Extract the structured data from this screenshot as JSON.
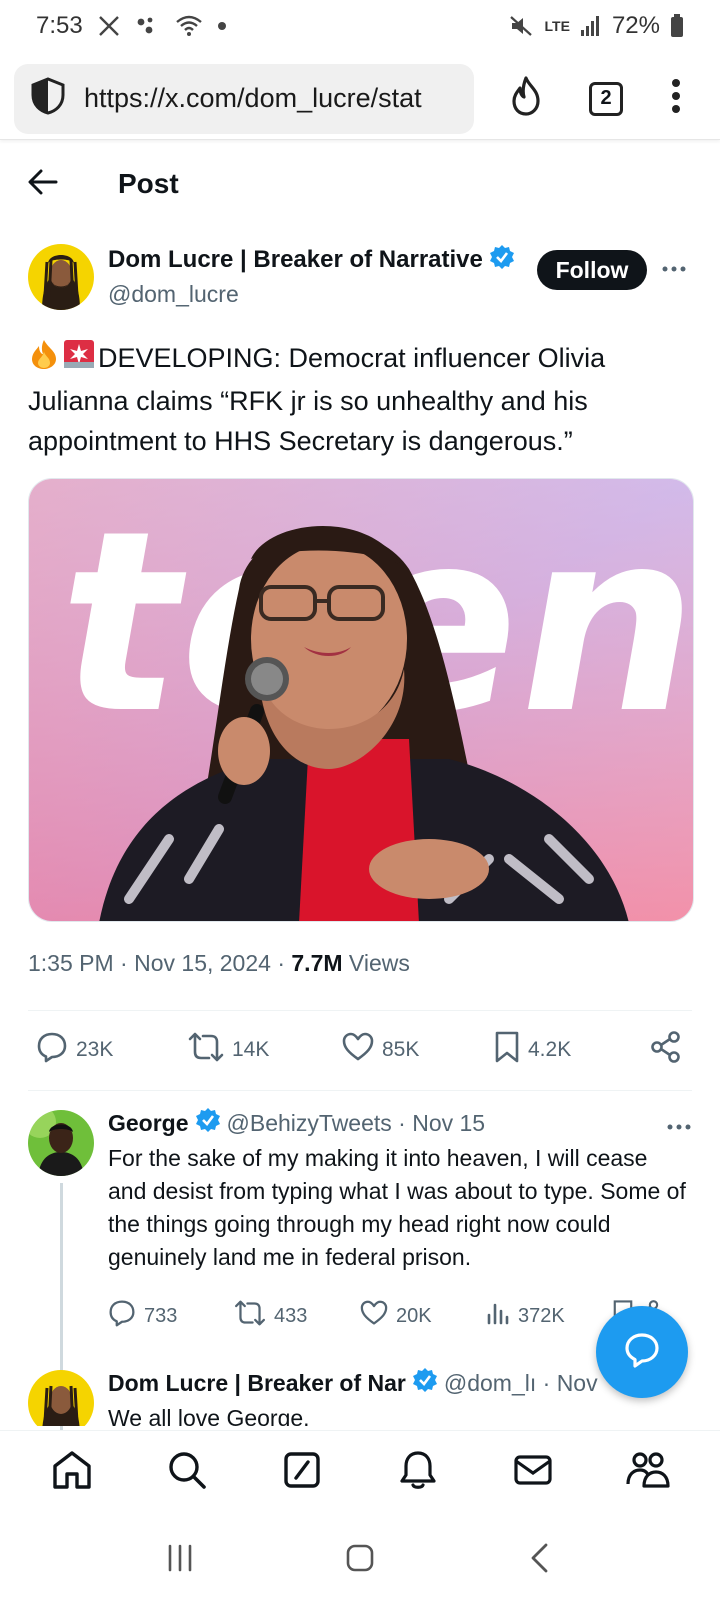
{
  "status_bar": {
    "time": "7:53",
    "battery": "72%",
    "network": "LTE"
  },
  "browser": {
    "url": "https://x.com/dom_lucre/stat",
    "tab_count": "2"
  },
  "header": {
    "title": "Post"
  },
  "post": {
    "author_name": "Dom Lucre | Breaker of Narrative",
    "author_handle": "@dom_lucre",
    "follow_label": "Follow",
    "text": "DEVELOPING: Democrat influencer Olivia Julianna claims “RFK jr is so unhealthy and his appointment to HHS Secretary is dangerous.”",
    "image_caption": "teen",
    "time": "1:35 PM",
    "date": "Nov 15, 2024",
    "views_count": "7.7M",
    "views_label": "Views",
    "stats": {
      "replies": "23K",
      "reposts": "14K",
      "likes": "85K",
      "bookmarks": "4.2K"
    }
  },
  "reply": {
    "author_name": "George",
    "handle_date": "@BehizyTweets · Nov 15",
    "text": "For the sake of my making it into heaven, I will cease and desist from typing what I was about to type. Some of the things going through my head right now could genuinely land me in federal prison.",
    "stats": {
      "replies": "733",
      "reposts": "433",
      "likes": "20K",
      "views": "372K"
    }
  },
  "reply2": {
    "author_name": "Dom Lucre | Breaker of Nar",
    "handle_date": "@dom_lı · Nov",
    "text": "We all love George."
  },
  "colors": {
    "accent": "#1d9bf0",
    "text": "#0f1419",
    "muted": "#536471"
  }
}
